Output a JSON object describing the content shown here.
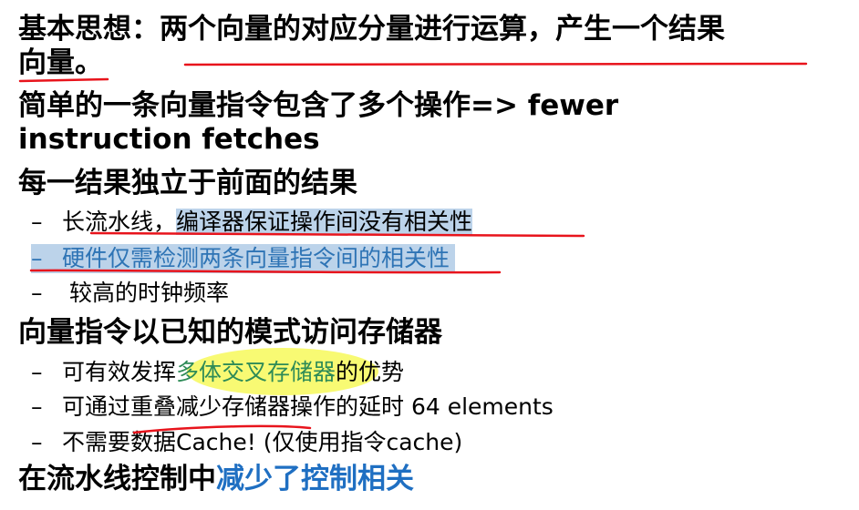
{
  "bullets": {
    "b1_line1": "基本思想：两个向量的对应分量进行运算，产生一个结果",
    "b1_line2": "向量。",
    "b2_line1": "简单的一条向量指令包含了多个操作=> fewer",
    "b2_line2": "instruction fetches",
    "b3": "每一结果独立于前面的结果",
    "b3_sub1_a": "长流水线，",
    "b3_sub1_b": "编译器保证操作间没有相关性",
    "b3_sub2": "硬件仅需检测两条向量指令间的相关性",
    "b3_sub3": " 较高的时钟频率",
    "b4": "向量指令以已知的模式访问存储器",
    "b4_sub1_a": "可有效发挥",
    "b4_sub1_b": "多体交叉存储器",
    "b4_sub1_c": "的优势",
    "b4_sub2": "可通过重叠减少存储器操作的延时  64 elements",
    "b4_sub3": "不需要数据Cache! (仅使用指令cache)",
    "b5_a": "在流水线控制中",
    "b5_b": "减少了控制相关"
  },
  "sub_marker": "–",
  "colors": {
    "highlight_blue": "#bcd3ea",
    "highlight_yellow": "#f7f95a",
    "annotation_red": "#e8141c",
    "blue_text": "#2e74b5",
    "green_text": "#2e8b57"
  }
}
